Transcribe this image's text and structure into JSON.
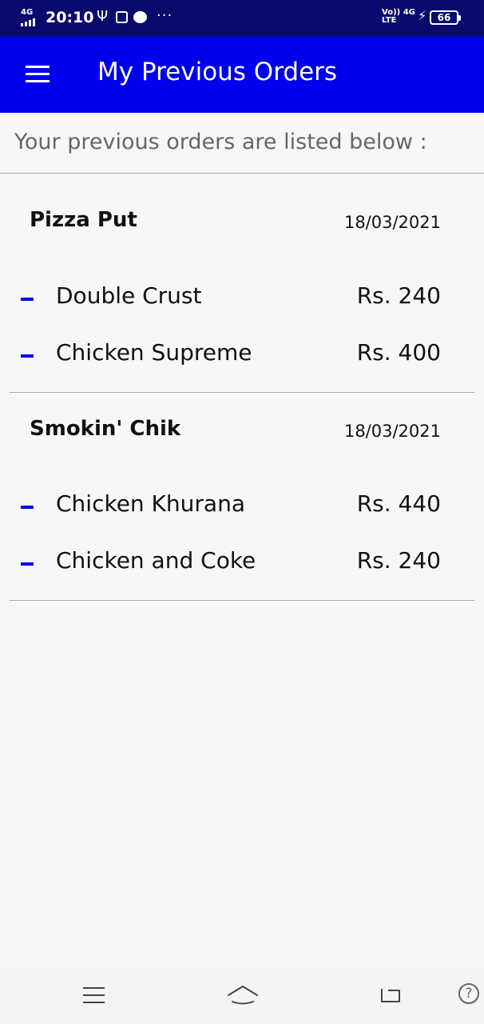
{
  "status_bar": {
    "network_type": "4G",
    "time": "20:10",
    "volte": "Vo))",
    "lte": "LTE",
    "net_4g": "4G",
    "battery": "66",
    "more": "···"
  },
  "app_bar": {
    "title": "My Previous Orders"
  },
  "subheader": "Your previous orders are listed below :",
  "orders": [
    {
      "restaurant": "Pizza Put",
      "date": "18/03/2021",
      "items": [
        {
          "name": "Double Crust",
          "price": "Rs. 240"
        },
        {
          "name": "Chicken Supreme",
          "price": "Rs. 400"
        }
      ]
    },
    {
      "restaurant": "Smokin' Chik",
      "date": "18/03/2021",
      "items": [
        {
          "name": "Chicken Khurana",
          "price": "Rs. 440"
        },
        {
          "name": "Chicken and Coke",
          "price": "Rs. 240"
        }
      ]
    }
  ],
  "nav": {
    "recent_icon": "recent-apps-icon",
    "home_icon": "home-icon",
    "back_icon": "back-icon",
    "help_icon": "help-icon",
    "help_glyph": "?"
  },
  "colors": {
    "app_bar": "#0000ee",
    "status_bar": "#0a0a6e",
    "accent_dash": "#0000ee"
  }
}
